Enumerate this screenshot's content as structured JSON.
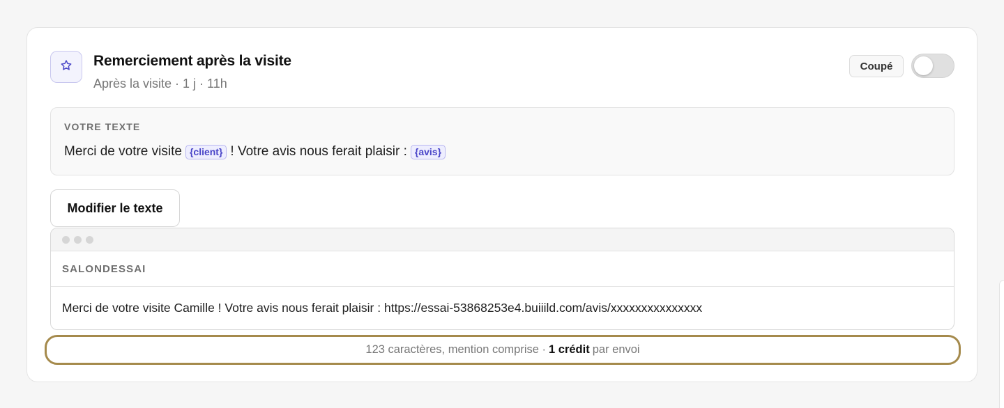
{
  "automation": {
    "title": "Remerciement après la visite",
    "subtitle": "Après la visite · 1 j · 11h",
    "icon": "star-icon",
    "status_label": "Coupé",
    "enabled": false
  },
  "template": {
    "label": "VOTRE TEXTE",
    "parts": {
      "text_before": "Merci de votre visite",
      "var_client": "{client}",
      "text_middle": "! Votre avis nous ferait plaisir :",
      "var_avis": "{avis}"
    }
  },
  "edit_button_label": "Modifier le texte",
  "preview": {
    "sender": "SALONDESSAI",
    "message": "Merci de votre visite Camille ! Votre avis nous ferait plaisir : https://essai-53868253e4.buiiild.com/avis/xxxxxxxxxxxxxxx"
  },
  "footer": {
    "prefix": "123 caractères, mention comprise ·",
    "credits": "1 crédit",
    "suffix": "par envoi"
  },
  "colors": {
    "accent": "#4a46c8",
    "highlight_border": "#a58a4c",
    "toggle_off": "#e0e0e0"
  }
}
